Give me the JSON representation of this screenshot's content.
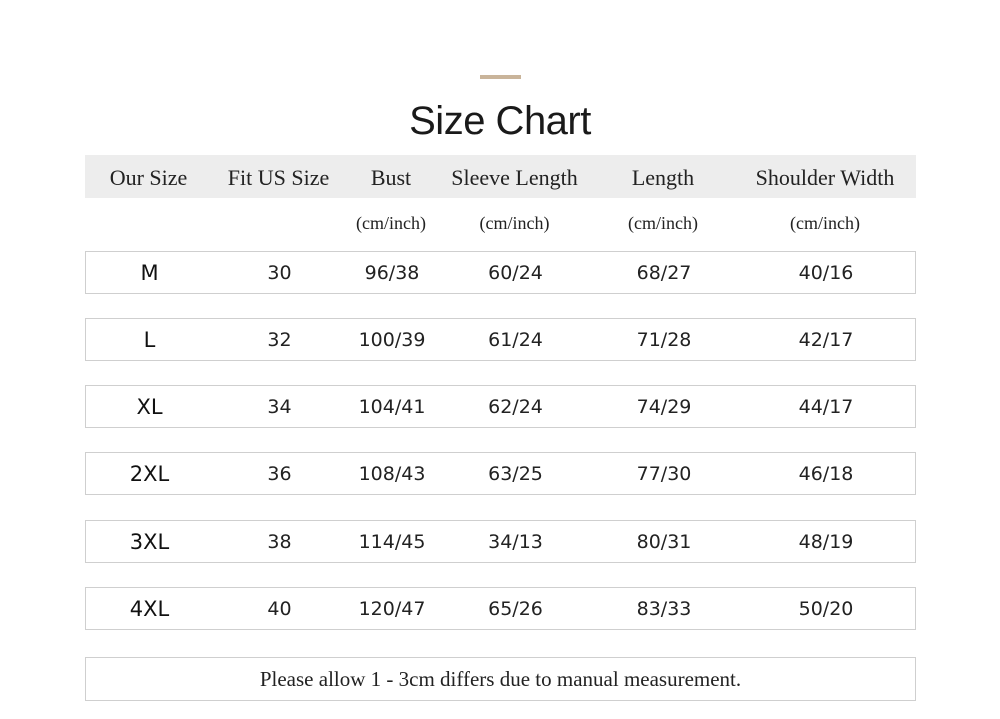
{
  "accent_color": "#c9b49a",
  "title": "Size Chart",
  "headers": [
    "Our Size",
    "Fit US Size",
    "Bust",
    "Sleeve Length",
    "Length",
    "Shoulder Width"
  ],
  "units": [
    "",
    "",
    "(cm/inch)",
    "(cm/inch)",
    "(cm/inch)",
    "(cm/inch)"
  ],
  "rows": [
    [
      "M",
      "30",
      "96/38",
      "60/24",
      "68/27",
      "40/16"
    ],
    [
      "L",
      "32",
      "100/39",
      "61/24",
      "71/28",
      "42/17"
    ],
    [
      "XL",
      "34",
      "104/41",
      "62/24",
      "74/29",
      "44/17"
    ],
    [
      "2XL",
      "36",
      "108/43",
      "63/25",
      "77/30",
      "46/18"
    ],
    [
      "3XL",
      "38",
      "114/45",
      "34/13",
      "80/31",
      "48/19"
    ],
    [
      "4XL",
      "40",
      "120/47",
      "65/26",
      "83/33",
      "50/20"
    ]
  ],
  "note": "Please allow 1 - 3cm differs due to manual measurement."
}
